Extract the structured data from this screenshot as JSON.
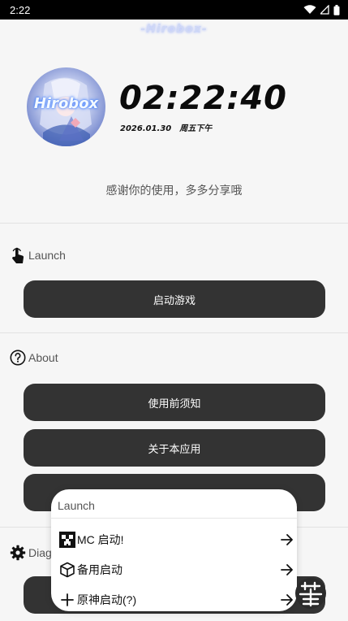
{
  "status_bar": {
    "time": "2:22"
  },
  "header": {
    "logo_text": "-Hirobox-",
    "avatar_text": "Hirobox"
  },
  "clock": {
    "time": "02:22:40",
    "date": "2026.01.30",
    "weekday": "周五下午"
  },
  "thanks_text": "感谢你的使用，多多分享哦",
  "launch_section": {
    "title": "Launch",
    "start_button": "启动游戏"
  },
  "about_section": {
    "title": "About",
    "buttons": [
      "使用前须知",
      "关于本应用"
    ]
  },
  "diag_section": {
    "title": "Diag"
  },
  "popup": {
    "title": "Launch",
    "items": [
      "MC 启动!",
      "备用启动",
      "原神启动(?)"
    ]
  },
  "colors": {
    "button_bg": "#333333",
    "page_bg": "#f6f6f6",
    "status_bar": "#000000"
  }
}
